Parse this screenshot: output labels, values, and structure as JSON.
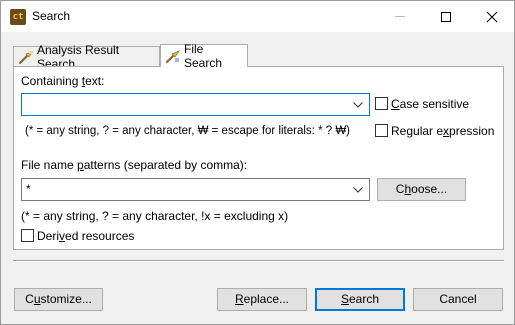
{
  "window": {
    "title": "Search",
    "app_icon_text": "ct",
    "controls": {
      "minimize_icon": "minimize-icon",
      "maximize_icon": "maximize-icon",
      "close_icon": "close-icon"
    }
  },
  "tabs": [
    {
      "label": "Analysis Result Search",
      "icon": "flashlight-search-icon",
      "selected": false
    },
    {
      "label": "File Search",
      "icon": "file-search-icon",
      "selected": true
    }
  ],
  "containing_text": {
    "label_pre": "Containing ",
    "label_mnemonic": "t",
    "label_post": "ext:",
    "value": "",
    "hint": "(* = any string, ? = any character, ₩ = escape for literals: * ? ₩)"
  },
  "case_sensitive": {
    "label_mnemonic": "C",
    "label_rest": "ase sensitive",
    "checked": false
  },
  "regular_expression": {
    "label_pre": "Regular e",
    "label_mnemonic": "x",
    "label_post": "pression",
    "checked": false
  },
  "file_name_patterns": {
    "label_pre": "File name ",
    "label_mnemonic": "p",
    "label_post": "atterns (separated by comma):",
    "value": "*",
    "hint": "(* = any string, ? = any character, !x = excluding x)"
  },
  "choose_button": {
    "label_pre": "C",
    "label_mnemonic": "h",
    "label_post": "oose..."
  },
  "derived_resources": {
    "label_pre": "Deri",
    "label_mnemonic": "v",
    "label_post": "ed resources",
    "checked": false
  },
  "footer": {
    "customize": {
      "label_pre": "C",
      "label_mnemonic": "u",
      "label_post": "stomize..."
    },
    "replace": {
      "label_pre": "",
      "label_mnemonic": "R",
      "label_post": "eplace..."
    },
    "search": {
      "label_pre": "",
      "label_mnemonic": "S",
      "label_post": "earch"
    },
    "cancel": {
      "label": "Cancel"
    }
  },
  "colors": {
    "focus_border": "#0078d7",
    "dialog_bg": "#f0f0f0",
    "panel_bg": "#ffffff"
  }
}
